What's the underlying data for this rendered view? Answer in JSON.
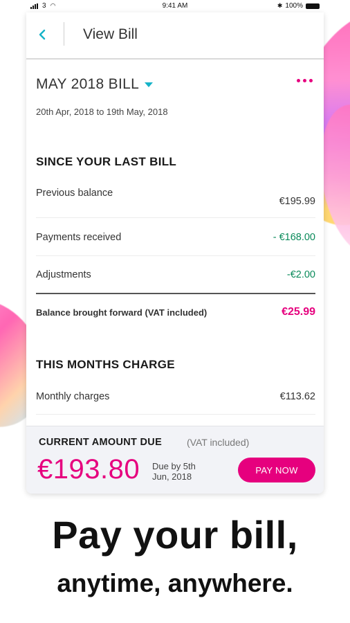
{
  "status_bar": {
    "carrier": "3",
    "time": "9:41 AM",
    "battery": "100%"
  },
  "header": {
    "back_icon": "chevron-left-icon",
    "title": "View Bill"
  },
  "bill": {
    "period_label": "MAY 2018 BILL",
    "date_range": "20th Apr, 2018 to 19th May, 2018",
    "more_icon": "more-dots-icon"
  },
  "since_last_bill": {
    "heading": "SINCE YOUR LAST BILL",
    "rows": [
      {
        "label": "Previous balance",
        "value": "€195.99"
      },
      {
        "label": "Payments received",
        "value": "- €168.00"
      },
      {
        "label": "Adjustments",
        "value": "-€2.00"
      }
    ],
    "total": {
      "label": "Balance brought forward (VAT included)",
      "value": "€25.99"
    }
  },
  "this_month": {
    "heading": "THIS MONTHS CHARGE",
    "rows": [
      {
        "label": "Monthly charges",
        "value": "€113.62"
      }
    ]
  },
  "amount_due": {
    "heading": "CURRENT AMOUNT DUE",
    "vat_note": "(VAT included)",
    "amount": "€193.80",
    "due_date": "Due by 5th Jun, 2018",
    "pay_label": "PAY NOW"
  },
  "promo": {
    "title": "Pay your bill,",
    "subtitle": "anytime, anywhere."
  },
  "colors": {
    "accent_pink": "#e6007e",
    "accent_teal": "#16b3c8",
    "credit_green": "#0a8a5a"
  }
}
